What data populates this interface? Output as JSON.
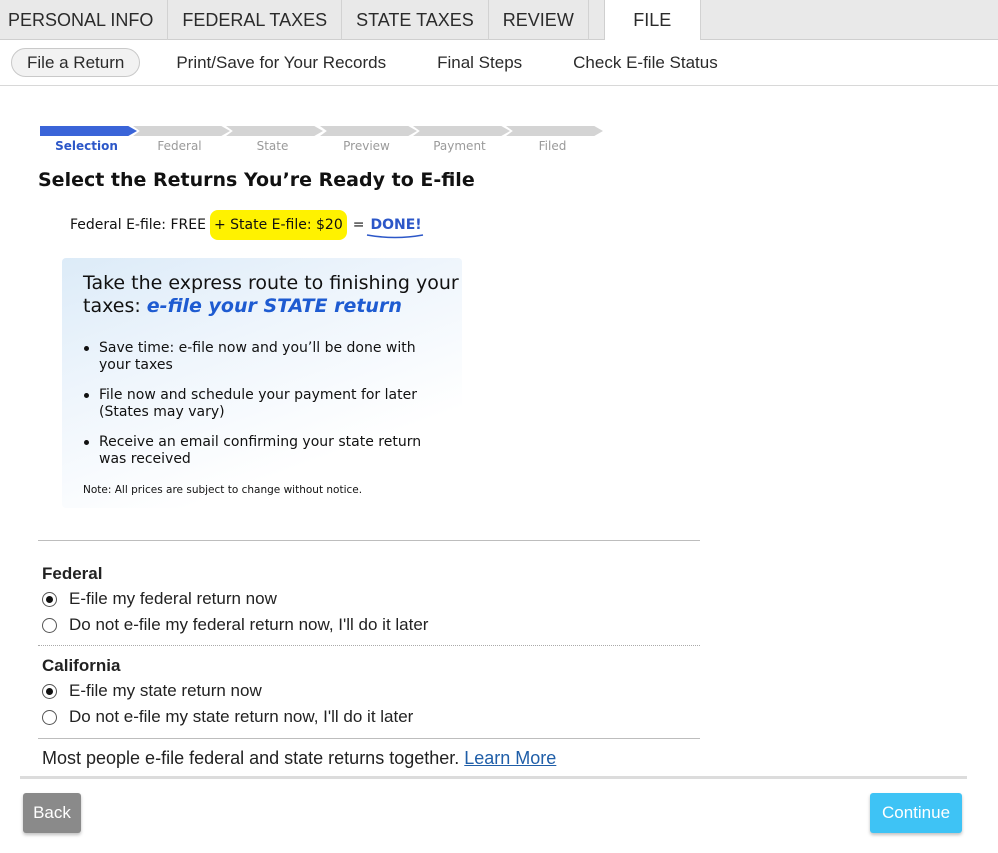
{
  "top_tabs": [
    {
      "label": "PERSONAL INFO"
    },
    {
      "label": "FEDERAL TAXES"
    },
    {
      "label": "STATE TAXES"
    },
    {
      "label": "REVIEW"
    },
    {
      "label": "FILE",
      "active": true
    }
  ],
  "sub_nav": [
    {
      "label": "File a Return",
      "active": true
    },
    {
      "label": "Print/Save for Your Records"
    },
    {
      "label": "Final Steps"
    },
    {
      "label": "Check E-file Status"
    }
  ],
  "progress_steps": [
    {
      "label": "Selection",
      "done": true
    },
    {
      "label": "Federal"
    },
    {
      "label": "State"
    },
    {
      "label": "Preview"
    },
    {
      "label": "Payment"
    },
    {
      "label": "Filed"
    }
  ],
  "heading": "Select the Returns You’re Ready to E-file",
  "pricing": {
    "federal": "Federal E-file: FREE",
    "state": "+ State E-file: $20",
    "equals": "=",
    "done": "DONE!",
    "highlight_color": "#fff200"
  },
  "promo": {
    "headline_plain": "Take the express route to finishing your taxes: ",
    "headline_emphasis": "e-file your STATE return",
    "bullets": [
      "Save time: e-file now and you’ll be done with your taxes",
      "File now and schedule your payment for later (States may vary)",
      "Receive an email confirming your state return was received"
    ],
    "note": "Note: All prices are subject to change without notice."
  },
  "federal_section": {
    "title": "Federal",
    "options": [
      {
        "label": "E-file my federal return now",
        "selected": true
      },
      {
        "label": "Do not e-file my federal return now, I'll do it later",
        "selected": false
      }
    ]
  },
  "state_section": {
    "title": "California",
    "options": [
      {
        "label": "E-file my state return now",
        "selected": true
      },
      {
        "label": "Do not e-file my state return now, I'll do it later",
        "selected": false
      }
    ]
  },
  "footer": {
    "text": "Most people e-file federal and state returns together. ",
    "link": "Learn More"
  },
  "buttons": {
    "back": "Back",
    "continue": "Continue"
  },
  "colors": {
    "accent_blue": "#2c57c8",
    "continue_button": "#3ec3f5",
    "back_button": "#8a8a8a"
  }
}
